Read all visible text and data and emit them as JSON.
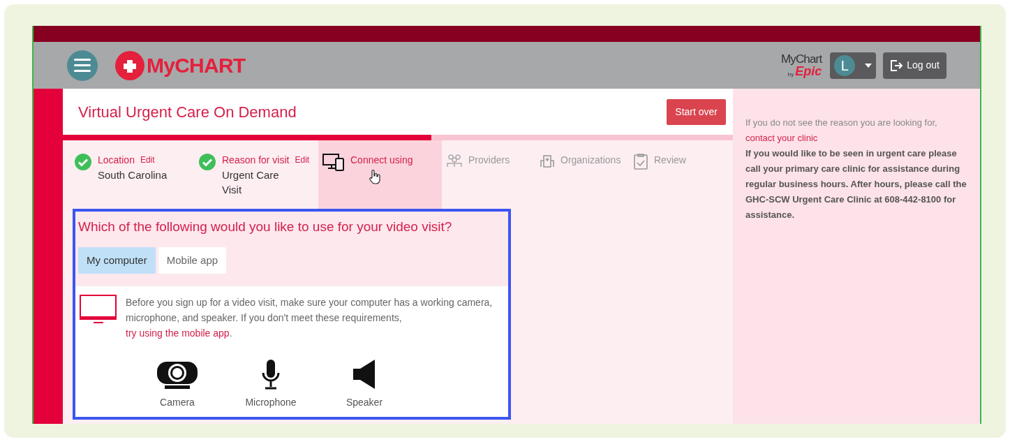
{
  "header": {
    "brand": "MyCHART",
    "vendor_logo": {
      "top": "MyChart",
      "by": "by",
      "name": "Epic"
    },
    "avatar_initial": "L",
    "logout": "Log out"
  },
  "page": {
    "title": "Virtual Urgent Care On Demand",
    "start_over": "Start over",
    "progress": {
      "level": 0.55
    }
  },
  "steps": [
    {
      "kind": "done",
      "label": "Location",
      "edit": "Edit",
      "value": "South Carolina",
      "selected": false
    },
    {
      "kind": "done",
      "label": "Reason for visit",
      "edit": "Edit",
      "value": "Urgent Care Visit",
      "selected": false
    },
    {
      "kind": "devices",
      "label": "Connect using",
      "selected": true
    },
    {
      "kind": "people",
      "label": "Providers",
      "selected": false
    },
    {
      "kind": "building",
      "label": "Organizations",
      "selected": false
    },
    {
      "kind": "clipboard",
      "label": "Review",
      "selected": false
    }
  ],
  "question": {
    "title": "Which of the following would you like to use for your video visit?",
    "options": [
      {
        "label": "My computer",
        "selected": true
      },
      {
        "label": "Mobile app",
        "selected": false
      }
    ],
    "notice": "Before you sign up for a video visit, make sure your computer has a working camera, microphone, and speaker. If you don't meet these requirements, ",
    "notice_link": "try using the mobile app",
    "notice_end": ".",
    "requirements": [
      {
        "kind": "camera",
        "label": "Camera"
      },
      {
        "kind": "microphone",
        "label": "Microphone"
      },
      {
        "kind": "speaker",
        "label": "Speaker"
      }
    ]
  },
  "sidebar": {
    "intro": "If you do not see the reason you are looking for,",
    "link": "contact your clinic",
    "note": "If you would like to be seen in urgent care please call your primary care clinic for assistance during regular business hours. After hours, please call the GHC-SCW Urgent Care Clinic at 608-442-8100 for assistance."
  }
}
